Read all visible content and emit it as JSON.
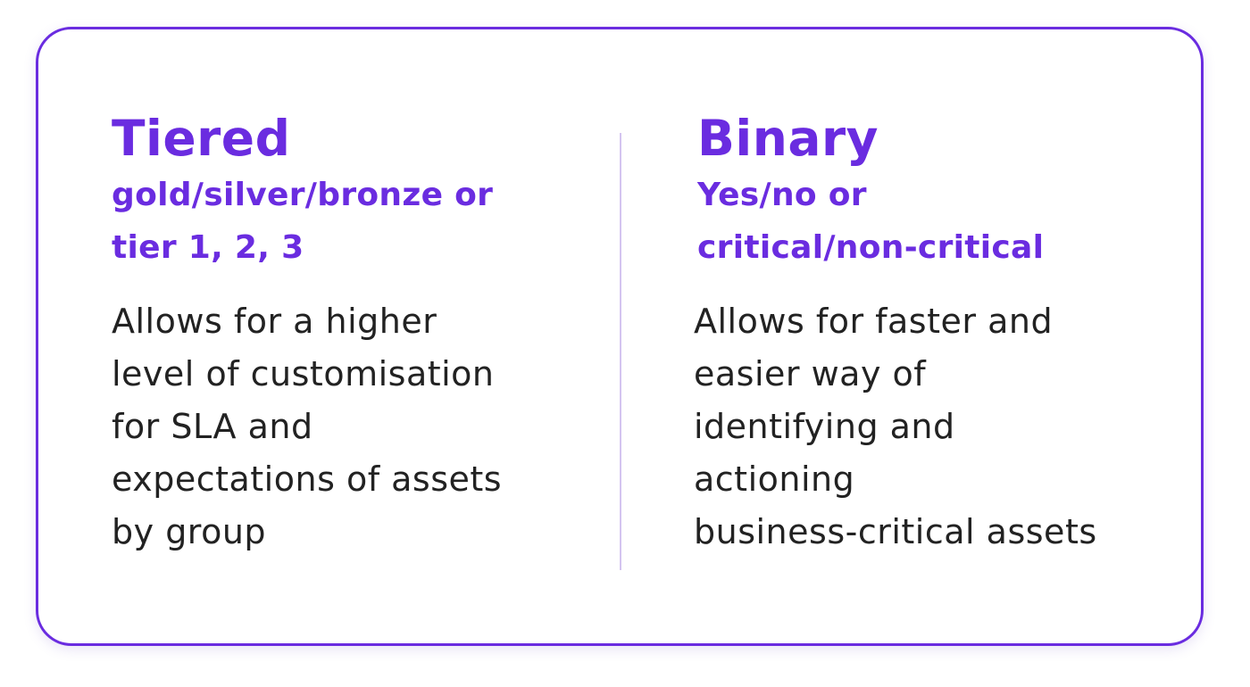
{
  "left": {
    "title": "Tiered",
    "subtitle": "gold/silver/bronze or\ntier 1, 2, 3",
    "description": "Allows for a higher\nlevel of customisation\nfor SLA and\nexpectations of assets\nby group"
  },
  "right": {
    "title": "Binary",
    "subtitle": "Yes/no or\ncritical/non-critical",
    "description": "Allows for faster and\neasier way of\nidentifying and\nactioning\nbusiness-critical assets"
  },
  "colors": {
    "accent": "#6a2ce0",
    "divider": "#d4c4f0",
    "text": "#222222"
  }
}
